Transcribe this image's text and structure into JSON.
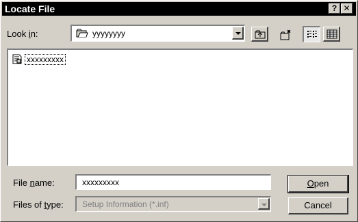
{
  "window": {
    "title": "Locate File"
  },
  "titlebar_buttons": {
    "help": "?",
    "close": "✕"
  },
  "look_in": {
    "label_pre": "Look ",
    "label_u": "i",
    "label_post": "n:",
    "value": "yyyyyyyy",
    "icon": "folder-icon"
  },
  "toolbar": {
    "up_icon": "up-one-level-icon",
    "new_folder_icon": "new-folder-icon",
    "list_icon": "list-view-icon",
    "details_icon": "details-view-icon"
  },
  "files": [
    {
      "name": "xxxxxxxxx",
      "icon": "setup-info-file-icon"
    }
  ],
  "file_name": {
    "label_pre": "File ",
    "label_u": "n",
    "label_post": "ame:",
    "value": "xxxxxxxxx"
  },
  "file_type": {
    "label_pre": "Files of ",
    "label_u": "t",
    "label_post": "ype:",
    "value": "Setup Information (*.inf)"
  },
  "buttons": {
    "open_u": "O",
    "open_rest": "pen",
    "cancel": "Cancel"
  }
}
